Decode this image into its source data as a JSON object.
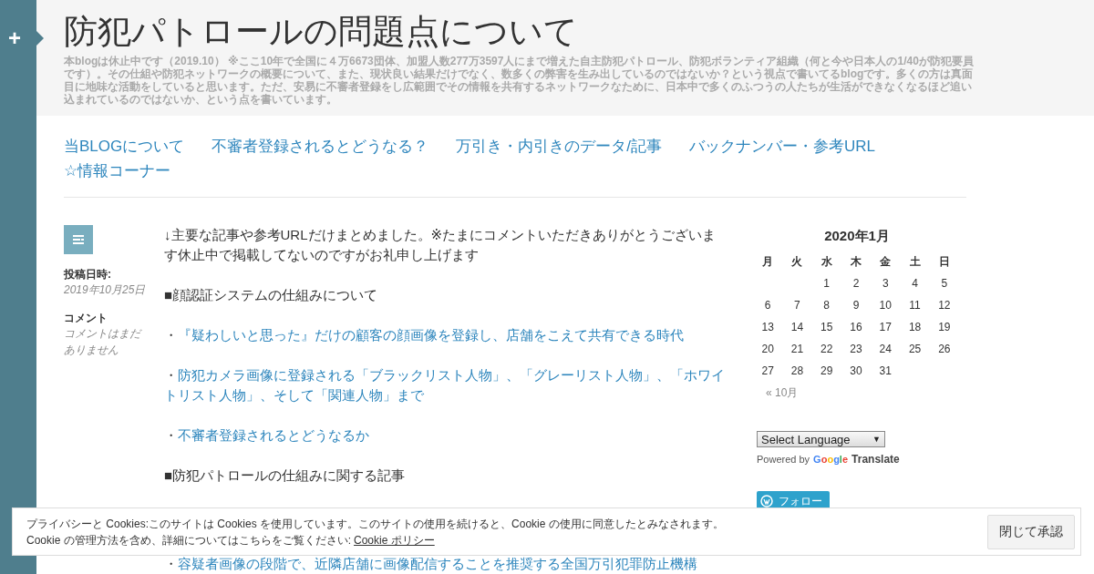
{
  "sidebar_toggle": {
    "label": "+"
  },
  "header": {
    "title": "防犯パトロールの問題点について",
    "description": "本blogは休止中です（2019.10） ※ここ10年で全国に４万6673団体、加盟人数277万3597人にまで増えた自主防犯パトロール、防犯ボランティア組織（何と今や日本人の1/40が防犯要員です）。その仕組や防犯ネットワークの概要について、また、現状良い結果だけでなく、数多くの弊害を生み出しているのではないか？という視点で書いてるblogです。多くの方は真面目に地味な活動をしていると思います。ただ、安易に不審者登録をし広範囲でその情報を共有するネットワークなために、日本中で多くのふつうの人たちが生活ができなくなるほど追い込まれているのではないか、という点を書いています。"
  },
  "nav": [
    "当BLOGについて",
    "不審者登録されるとどうなる？",
    "万引き・内引きのデータ/記事",
    "バックナンバー・参考URL",
    "☆情報コーナー"
  ],
  "post_meta": {
    "date_label": "投稿日時:",
    "date": "2019年10月25日",
    "comments_label": "コメント",
    "comments": "コメントはまだありません"
  },
  "post_body": [
    {
      "kind": "text",
      "text": "↓主要な記事や参考URLだけまとめました。※たまにコメントいただきありがとうございます休止中で掲載してないのですがお礼申し上げます"
    },
    {
      "kind": "text",
      "text": "■顔認証システムの仕組みについて"
    },
    {
      "kind": "link",
      "bullet": "・",
      "text": "『疑わしいと思った』だけの顧客の顔画像を登録し、店舗をこえて共有できる時代"
    },
    {
      "kind": "link",
      "bullet": "・",
      "text": "防犯カメラ画像に登録される「ブラックリスト人物」、「グレーリスト人物」、「ホワイトリスト人物」、そして「関連人物」まで"
    },
    {
      "kind": "link",
      "bullet": "・",
      "text": "不審者登録されるとどうなるか"
    },
    {
      "kind": "text",
      "text": "■防犯パトロールの仕組みに関する記事"
    },
    {
      "kind": "link",
      "bullet": "・",
      "text": "容疑者画像の段階で、近隣店舗に画像配信することを推奨する全国万引犯罪防止機構"
    }
  ],
  "calendar": {
    "title": "2020年1月",
    "weekdays": [
      "月",
      "火",
      "水",
      "木",
      "金",
      "土",
      "日"
    ],
    "weeks": [
      [
        "1",
        "2",
        "3",
        "4",
        "5"
      ],
      [
        "6",
        "7",
        "8",
        "9",
        "10",
        "11",
        "12"
      ],
      [
        "13",
        "14",
        "15",
        "16",
        "17",
        "18",
        "19"
      ],
      [
        "20",
        "21",
        "22",
        "23",
        "24",
        "25",
        "26"
      ],
      [
        "27",
        "28",
        "29",
        "30",
        "31"
      ]
    ],
    "prev": "« 10月"
  },
  "translate": {
    "select": "Select Language",
    "caret": "▼",
    "powered_by": "Powered by",
    "google": "Google",
    "translate": "Translate"
  },
  "follow_button": {
    "label": "フォロー"
  },
  "cookie_banner": {
    "line1": "プライバシーと Cookies:このサイトは Cookies を使用しています。このサイトの使用を続けると、Cookie の使用に同意したとみなされます。",
    "line2": "Cookie の管理方法を含め、詳細についてはこちらをご覧ください:",
    "policy_link": "Cookie ポリシー",
    "accept": "閉じて承認"
  }
}
